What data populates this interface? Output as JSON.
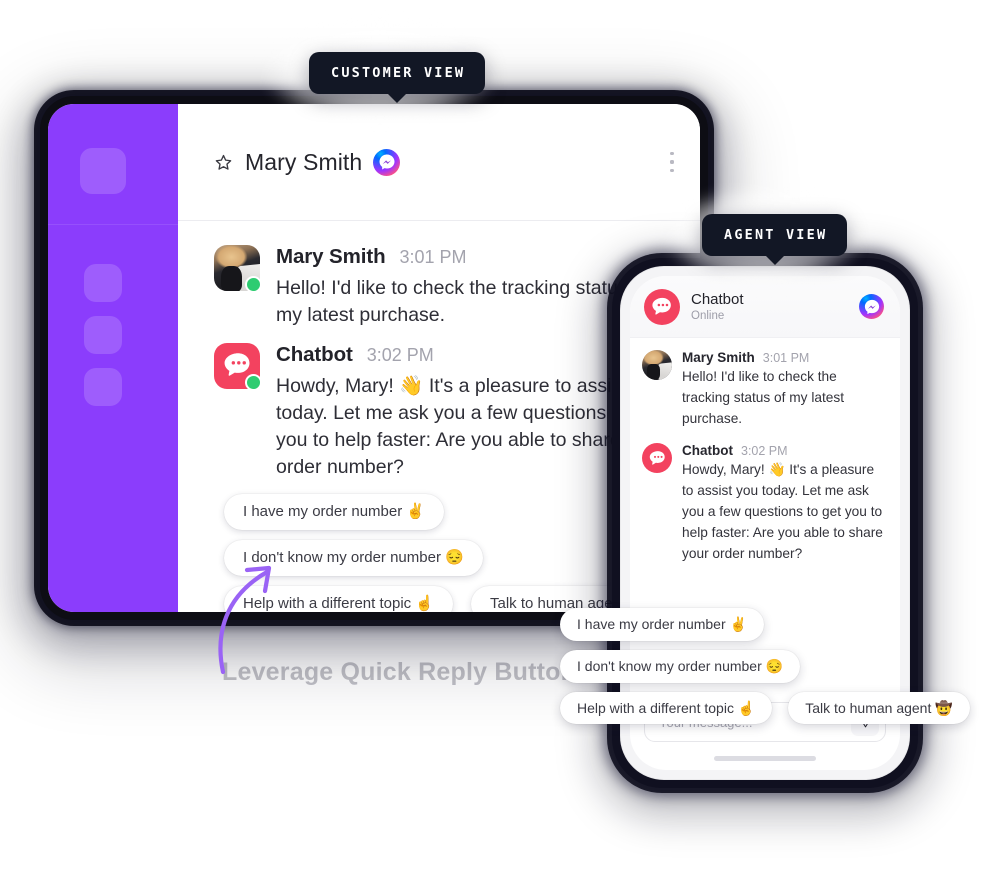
{
  "labels": {
    "customer_view": "CUSTOMER VIEW",
    "agent_view": "AGENT VIEW"
  },
  "background_caption": "Leverage Quick Reply Buttons",
  "colors": {
    "sidebar_purple": "#8b3dfc",
    "bot_red": "#f3425f",
    "online_green": "#2ecc71",
    "tooltip_navy": "#121725",
    "arrow_purple": "#9a63f5"
  },
  "desktop": {
    "sidebar": {
      "tiles": [
        "app-logo-tile",
        "nav-tile-1",
        "nav-tile-2",
        "nav-tile-3"
      ]
    },
    "header": {
      "star_icon": "star-icon",
      "title": "Mary Smith",
      "channel_icon": "messenger-icon",
      "menu_icon": "kebab-menu-icon"
    },
    "messages": [
      {
        "author": "Mary Smith",
        "time": "3:01 PM",
        "text": "Hello! I'd like to check the tracking status of my latest purchase.",
        "avatar": "customer-photo-avatar",
        "online": true
      },
      {
        "author": "Chatbot",
        "time": "3:02 PM",
        "text": "Howdy, Mary! 👋 It's a pleasure to assist you today. Let me ask you a few questions to get you to help faster: Are you able to share your order number?",
        "avatar": "chatbot-avatar",
        "online": true
      }
    ],
    "quick_replies": [
      "I have my order number ✌️",
      "I don't know my order number 😔",
      "Help with a different topic ☝️",
      "Talk to human agent 🤠"
    ]
  },
  "phone": {
    "header": {
      "name": "Chatbot",
      "status": "Online",
      "avatar": "chatbot-avatar",
      "channel_icon": "messenger-icon"
    },
    "messages": [
      {
        "author": "Mary Smith",
        "time": "3:01 PM",
        "text": "Hello! I'd like to check the tracking status of my latest purchase.",
        "avatar": "customer-photo-avatar"
      },
      {
        "author": "Chatbot",
        "time": "3:02 PM",
        "text": "Howdy, Mary! 👋 It's a pleasure to assist you today. Let me ask you a few questions to get you to help faster: Are you able to share your order number?",
        "avatar": "chatbot-avatar"
      }
    ],
    "quick_replies": [
      "I have my order number ✌️",
      "I don't know my order number 😔",
      "Help with a different topic ☝️",
      "Talk to human agent 🤠"
    ],
    "composer": {
      "placeholder": "Your message...",
      "send_icon": "send-icon"
    }
  }
}
